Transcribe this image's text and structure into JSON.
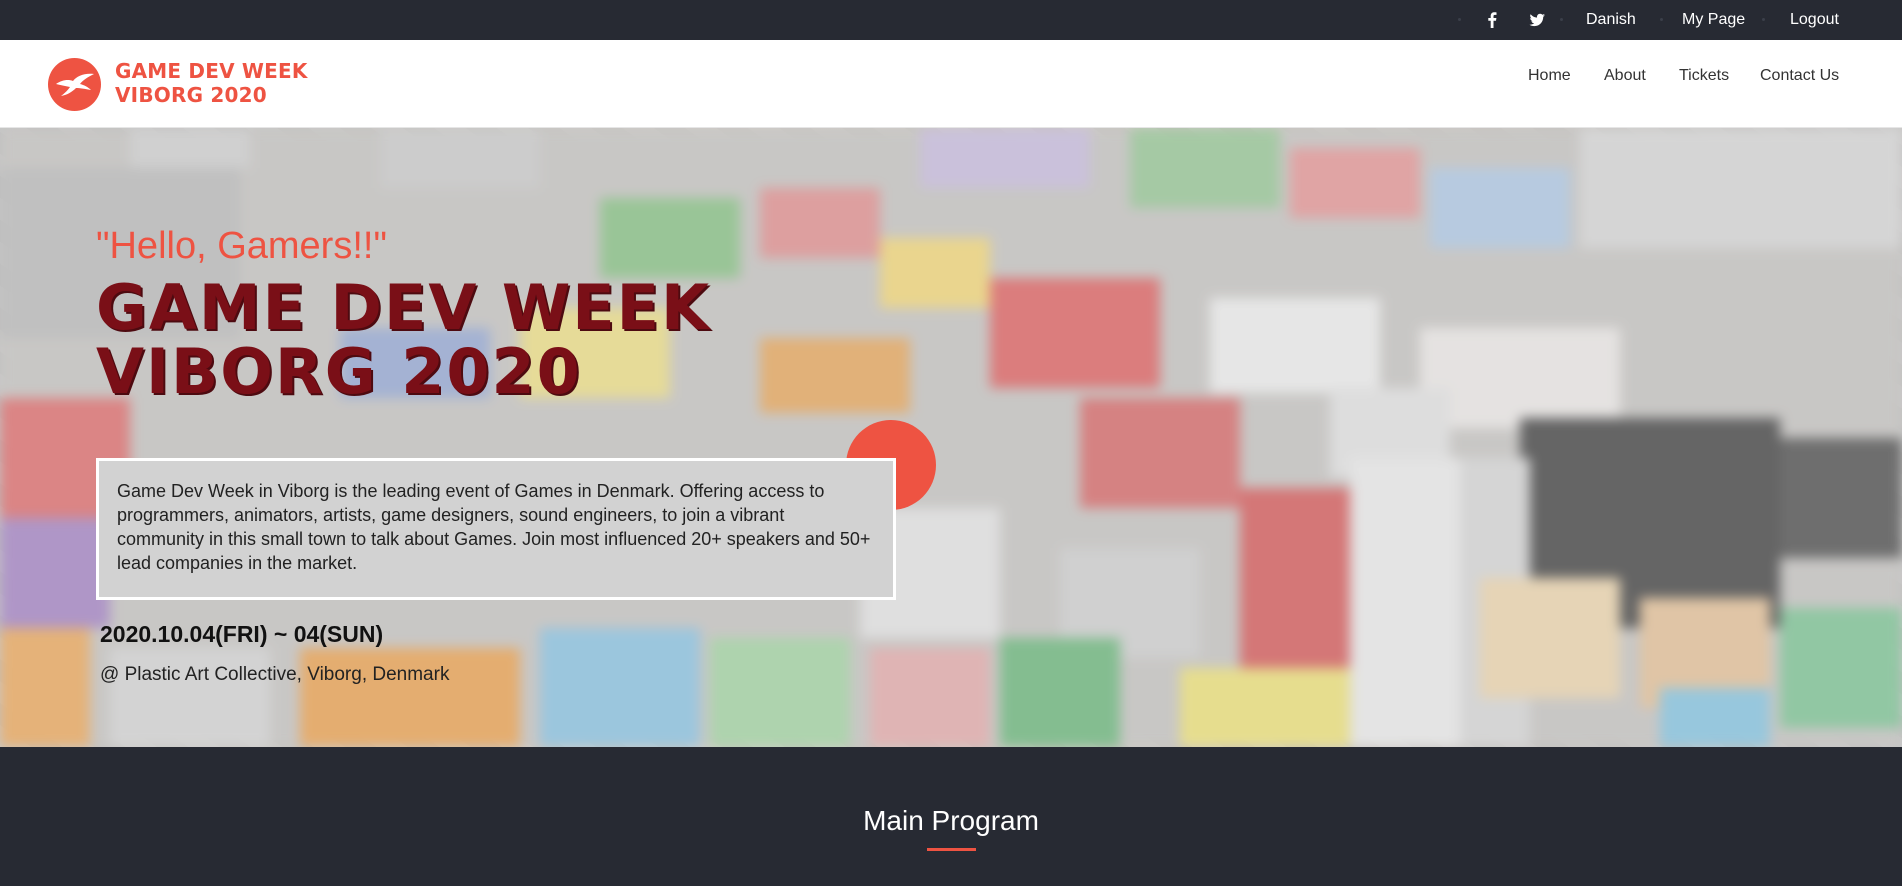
{
  "topbar": {
    "social": [
      {
        "icon": "facebook-icon",
        "glyph": "f"
      },
      {
        "icon": "twitter-icon",
        "glyph": "t"
      }
    ],
    "language_label": "Danish",
    "mypage_label": "My Page",
    "logout_label": "Logout"
  },
  "header": {
    "logo_line1": "GAME DEV WEEK",
    "logo_line2": "VIBORG 2020",
    "nav": {
      "home": "Home",
      "about": "About",
      "tickets": "Tickets",
      "contact": "Contact Us"
    }
  },
  "hero": {
    "greeting": "\"Hello, Gamers!!\"",
    "title_line1": "GAME DEV WEEK",
    "title_line2": "VIBORG 2020",
    "description": "Game Dev Week in Viborg is the leading event of Games in Denmark. Offering access to programmers, animators, artists, game designers, sound engineers, to join a vibrant community in this small town to talk about Games. Join most influenced 20+ speakers and 50+ lead companies in the market.",
    "date": "2020.10.04(FRI) ~ 04(SUN)",
    "venue": "@ Plastic Art Collective, Viborg, Denmark"
  },
  "program": {
    "title": "Main Program"
  },
  "colors": {
    "accent": "#ee5342",
    "dark": "#272a33",
    "title_red": "#7a0f17",
    "white": "#ffffff"
  }
}
